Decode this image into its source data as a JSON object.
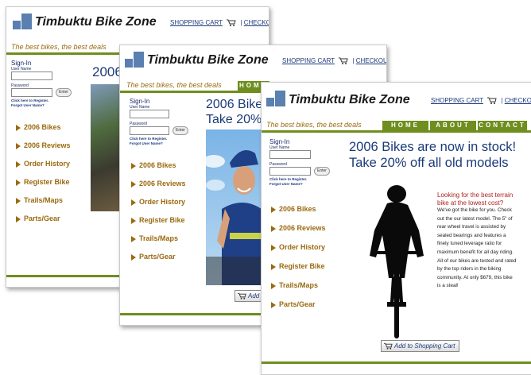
{
  "site": {
    "name": "Timbuktu Bike Zone",
    "tagline": "The best bikes, the best deals",
    "shopping_cart": "SHOPPING CART",
    "separator": "|",
    "checkout": "CHECKOUT",
    "colors": {
      "accent": "#6e8e1e",
      "tagline": "#9a6a10",
      "link": "#1b3a7a",
      "logo": "#5a7fb0"
    }
  },
  "nav": {
    "home": "HOME",
    "about": "ABOUT",
    "contact": "CONTACT"
  },
  "signin": {
    "title": "Sign-In",
    "username_label": "User Name",
    "password_label": "Password",
    "enter": "Enter",
    "register": "Click here to Register.",
    "forgot": "Forgot User Name?"
  },
  "menu": [
    "2006 Bikes",
    "2006 Reviews",
    "Order History",
    "Register Bike",
    "Trails/Maps",
    "Parts/Gear"
  ],
  "front": {
    "headline1": "2006 Bikes are now in stock!",
    "headline2": "Take 20% off all old models",
    "promo_title": "Looking for the best terrain bike at the lowest cost?",
    "promo_body": "We've got the bike for you. Check out the our latest model. The 5\" of rear wheel travel is assisted by sealed bearings and features a finely tuned leverage ratio for maximum benefit for all day riding. All of our bikes are tested and rated by the top riders in the biking community. At only $679, this bike is a steal!",
    "add_to_cart": "Add to Shopping Cart"
  },
  "middle": {
    "headline1": "2006 Bike",
    "headline2": "Take 20%",
    "add_short": "Add"
  },
  "back": {
    "headline": "2006"
  }
}
